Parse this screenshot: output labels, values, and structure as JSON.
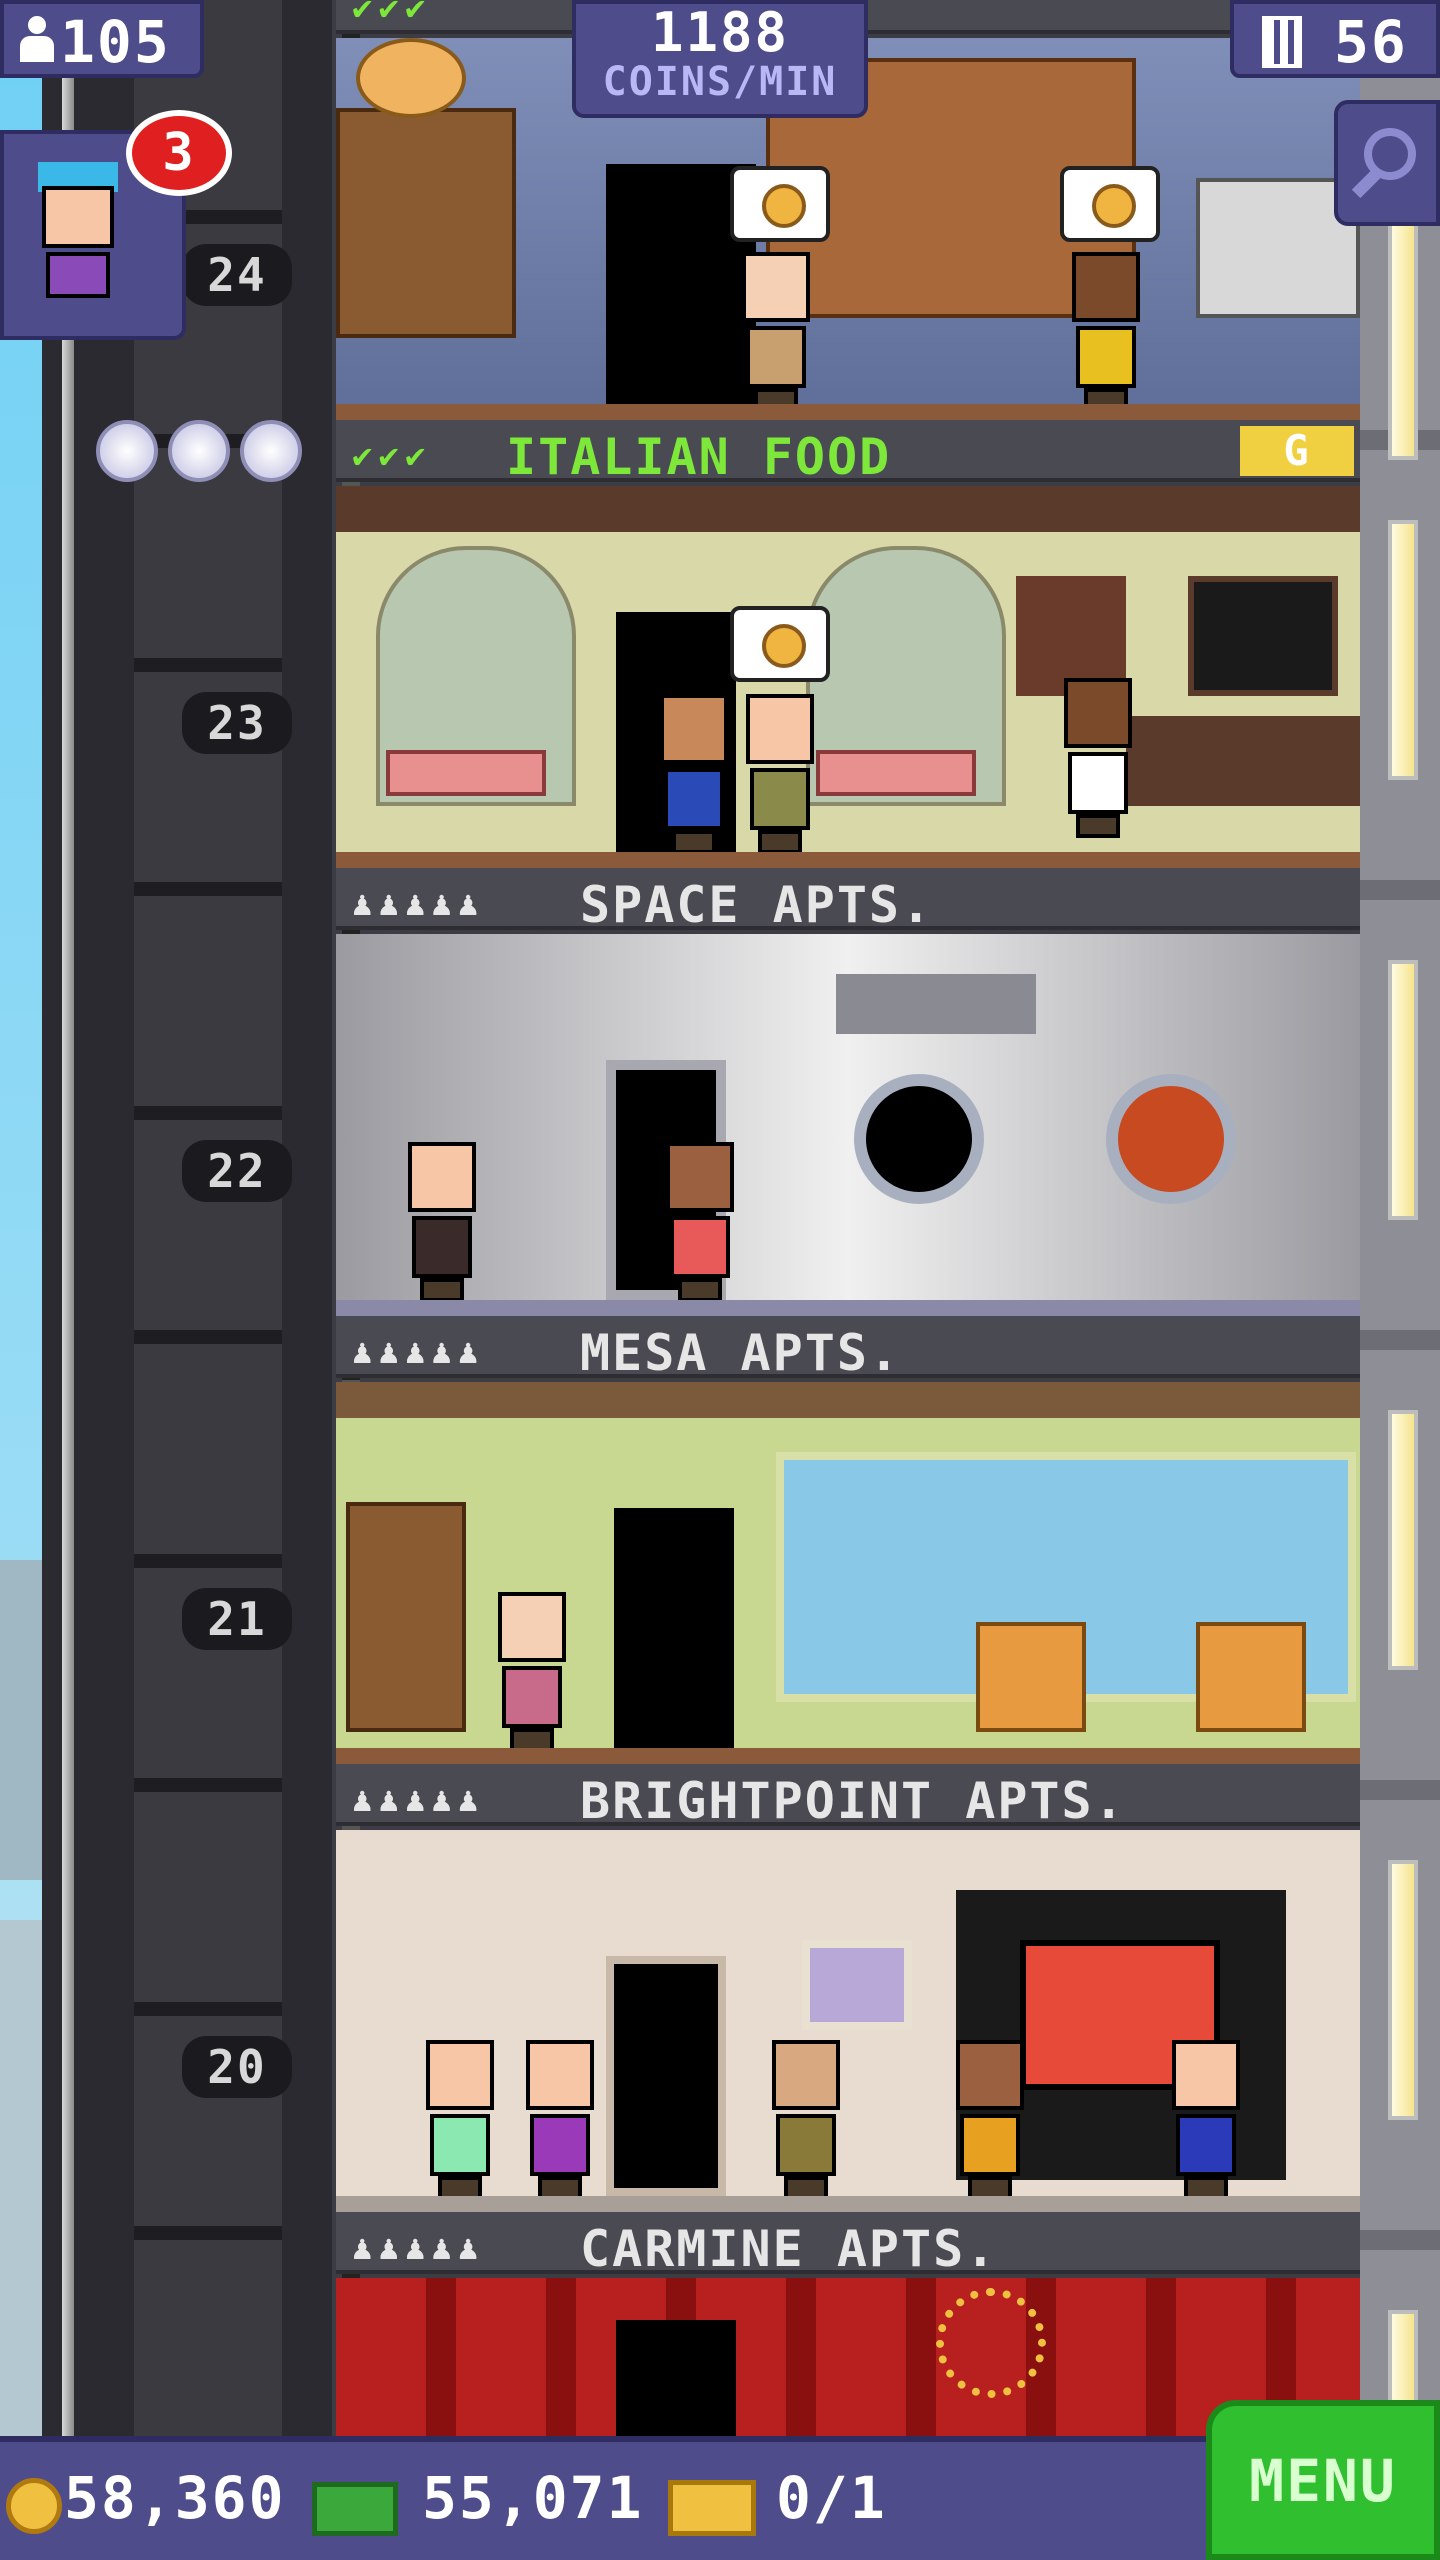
{
  "hud": {
    "population": "105",
    "coins_per_min_value": "1188",
    "coins_per_min_unit": "COINS/MIN",
    "floor_count": "56",
    "notification_count": "3"
  },
  "elevator": {
    "floor_numbers": [
      "24",
      "23",
      "22",
      "21",
      "20"
    ]
  },
  "floors": [
    {
      "name": "",
      "type": "bakery",
      "stock_checks": "✔✔✔",
      "bubble": "coin"
    },
    {
      "name": "ITALIAN FOOD",
      "stock_checks": "✔✔✔",
      "badge": "G"
    },
    {
      "name": "SPACE APTS.",
      "residents": "♟♟♟♟♟"
    },
    {
      "name": "MESA APTS.",
      "residents": "♟♟♟♟♟"
    },
    {
      "name": "BRIGHTPOINT APTS.",
      "residents": "♟♟♟♟♟"
    },
    {
      "name": "CARMINE APTS.",
      "residents": "♟♟♟♟♟"
    }
  ],
  "bottom_bar": {
    "coins": "58,360",
    "bux": "55,071",
    "tickets": "0/1",
    "menu_label": "MENU"
  },
  "colors": {
    "hud_bg": "#4e4c8a",
    "menu_green": "#2fbf2f",
    "store_label_green": "#7ee83a"
  },
  "icons": {
    "population": "person-icon",
    "floors": "building-icon",
    "search": "magnifier-icon",
    "coins": "coin-icon",
    "bux": "tower-bux-icon",
    "tickets": "golden-ticket-icon"
  }
}
